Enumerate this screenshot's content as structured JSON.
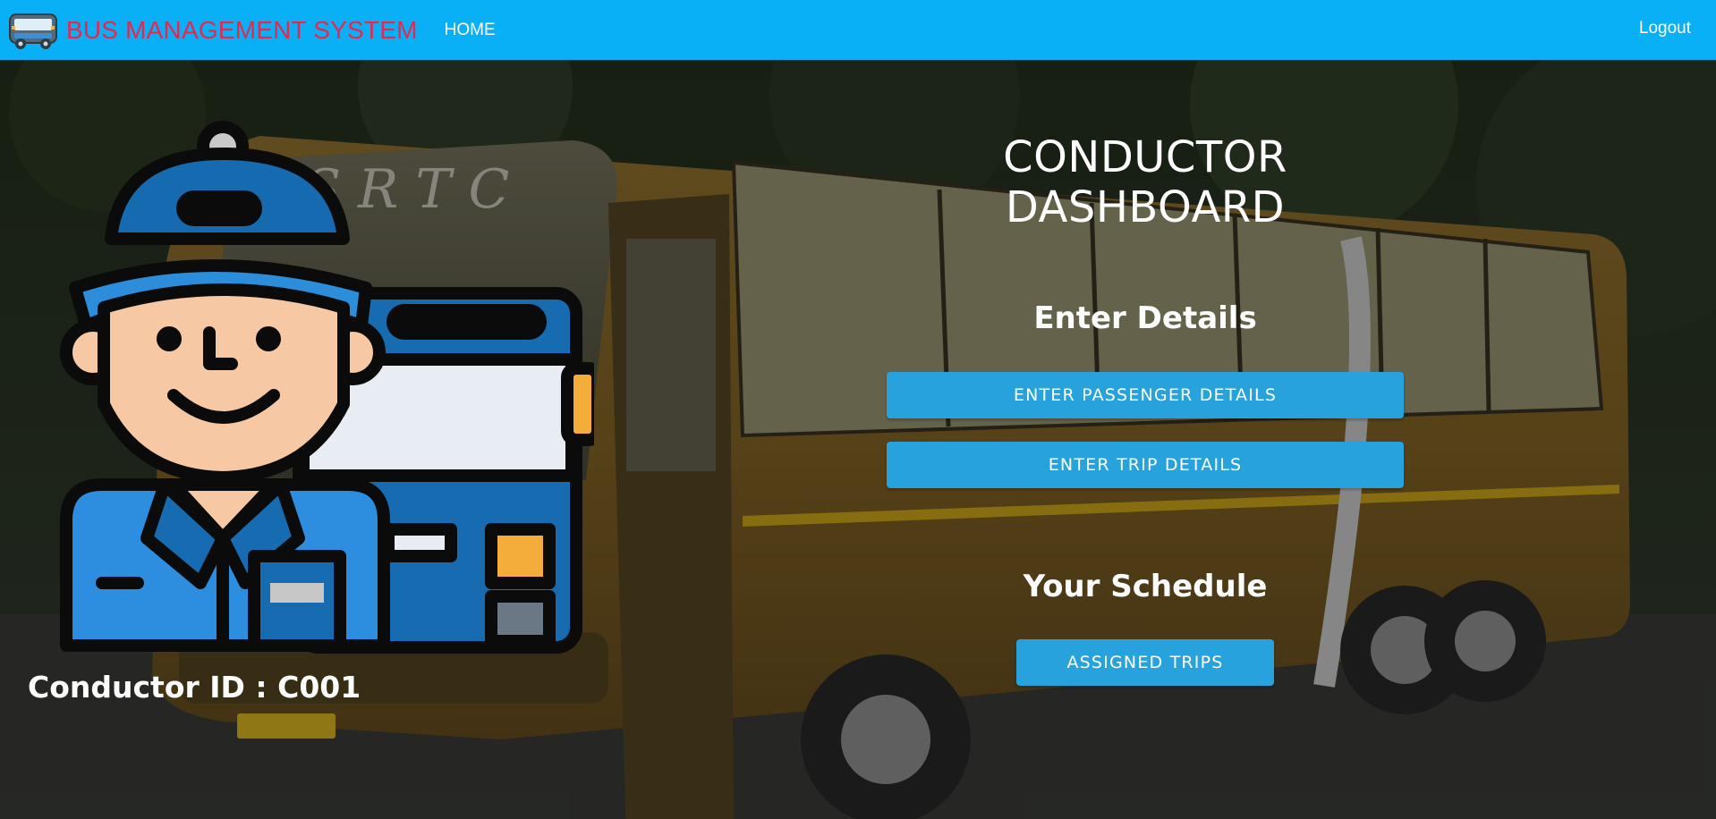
{
  "navbar": {
    "brand_icon": "bus-icon",
    "brand_text": "BUS MANAGEMENT SYSTEM",
    "home_label": "HOME",
    "logout_label": "Logout",
    "background_color": "#0ab0f6",
    "brand_color": "#e8274f"
  },
  "hero": {
    "illustration": "bus-conductor-illustration",
    "conductor_id_text": "Conductor ID : C001"
  },
  "dashboard": {
    "title": "CONDUCTOR DASHBOARD",
    "enter_details": {
      "heading": "Enter Details",
      "passenger_button": "ENTER PASSENGER DETAILS",
      "trip_button": "ENTER TRIP DETAILS"
    },
    "schedule": {
      "heading": "Your Schedule",
      "assigned_button": "ASSIGNED TRIPS"
    },
    "button_color": "#27a2dc"
  }
}
